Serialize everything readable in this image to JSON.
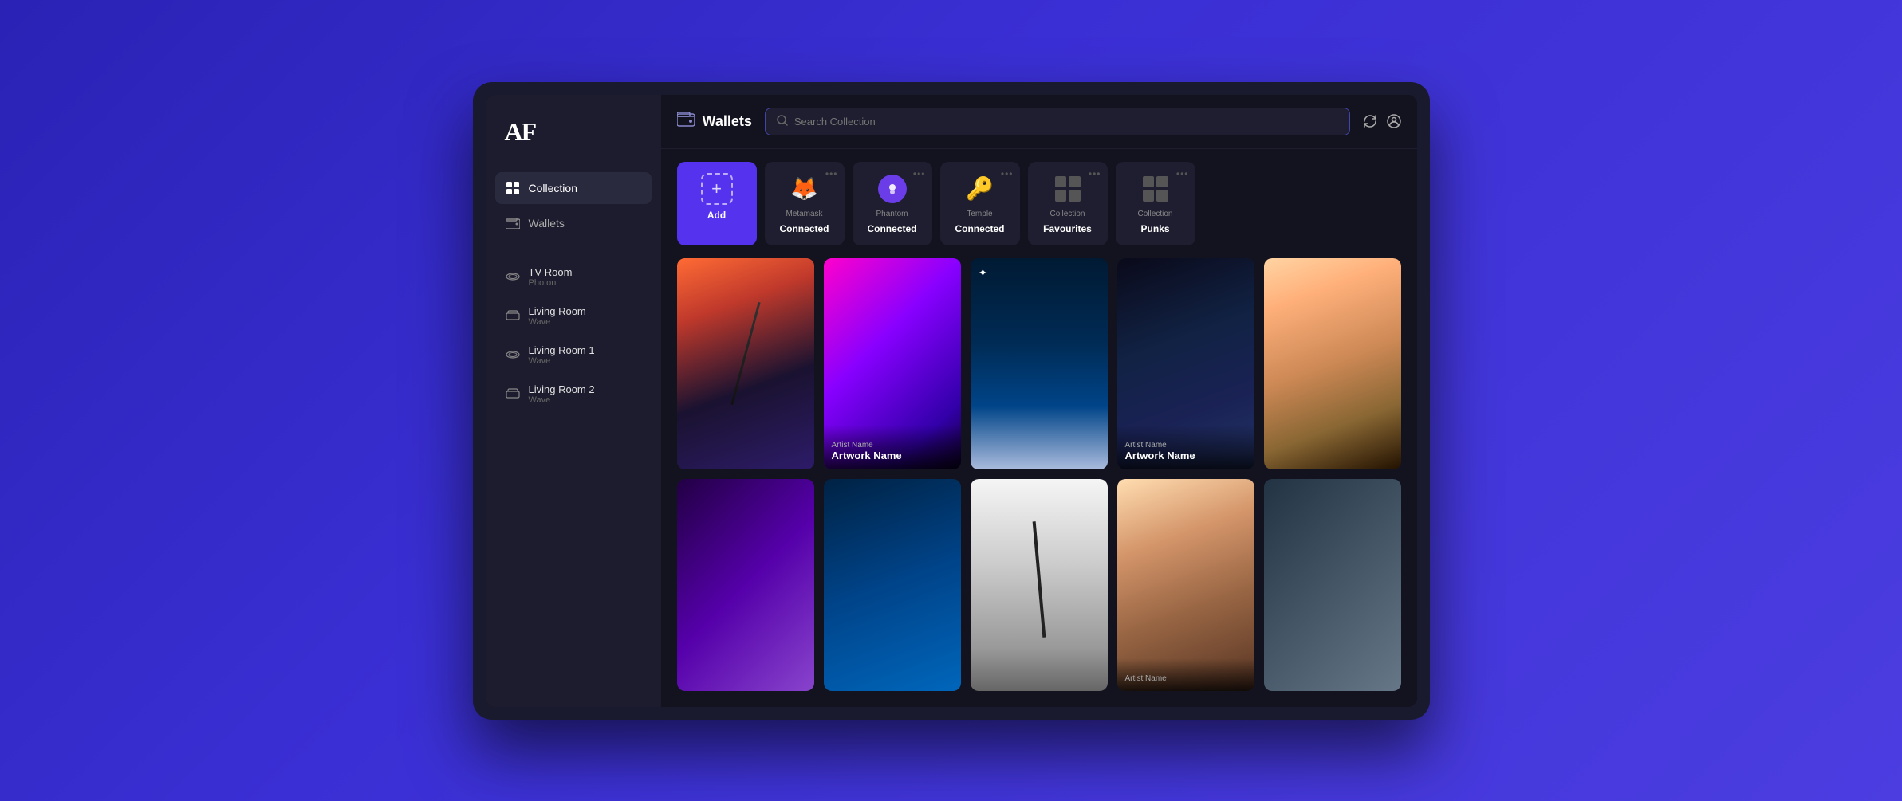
{
  "app": {
    "logo": "AF"
  },
  "sidebar": {
    "nav_items": [
      {
        "id": "collection",
        "label": "Collection",
        "active": true
      },
      {
        "id": "wallets",
        "label": "Wallets",
        "active": false
      }
    ],
    "rooms": [
      {
        "id": "tv-room",
        "name": "TV Room",
        "sub": "Photon"
      },
      {
        "id": "living-room",
        "name": "Living Room",
        "sub": "Wave"
      },
      {
        "id": "living-room-1",
        "name": "Living Room 1",
        "sub": "Wave"
      },
      {
        "id": "living-room-2",
        "name": "Living Room 2",
        "sub": "Wave"
      }
    ]
  },
  "header": {
    "title": "Wallets",
    "search_placeholder": "Search Collection",
    "refresh_label": "Refresh",
    "account_label": "Account"
  },
  "wallets": [
    {
      "id": "add",
      "type": "add",
      "label": "Add",
      "label_top": ""
    },
    {
      "id": "metamask",
      "type": "metamask",
      "label": "Connected",
      "label_top": "Metamask"
    },
    {
      "id": "phantom",
      "type": "phantom",
      "label": "Connected",
      "label_top": "Phantom"
    },
    {
      "id": "temple",
      "type": "temple",
      "label": "Connected",
      "label_top": "Temple"
    },
    {
      "id": "favourites",
      "type": "grid",
      "label": "Favourites",
      "label_top": "Collection"
    },
    {
      "id": "punks",
      "type": "grid",
      "label": "Punks",
      "label_top": "Collection"
    }
  ],
  "artworks": [
    {
      "id": "art1",
      "artist": "",
      "name": "",
      "class": "art-1",
      "has_overlay": false
    },
    {
      "id": "art2",
      "artist": "Artist Name",
      "name": "Artwork Name",
      "class": "art-2",
      "has_overlay": true
    },
    {
      "id": "art3",
      "artist": "",
      "name": "",
      "class": "art-3",
      "has_overlay": false,
      "has_sparkle": true
    },
    {
      "id": "art4",
      "artist": "Artist Name",
      "name": "Artwork Name",
      "class": "art-4",
      "has_overlay": true
    },
    {
      "id": "art5",
      "artist": "",
      "name": "",
      "class": "art-5",
      "has_overlay": false
    },
    {
      "id": "art6",
      "artist": "",
      "name": "",
      "class": "art-6",
      "has_overlay": false
    },
    {
      "id": "art7",
      "artist": "",
      "name": "",
      "class": "art-7",
      "has_overlay": false
    },
    {
      "id": "art8",
      "artist": "",
      "name": "",
      "class": "art-8",
      "has_overlay": false
    },
    {
      "id": "art9",
      "artist": "Artist Name",
      "name": "",
      "class": "art-9",
      "has_overlay": true
    },
    {
      "id": "art10",
      "artist": "",
      "name": "",
      "class": "art-10",
      "has_overlay": false
    }
  ]
}
